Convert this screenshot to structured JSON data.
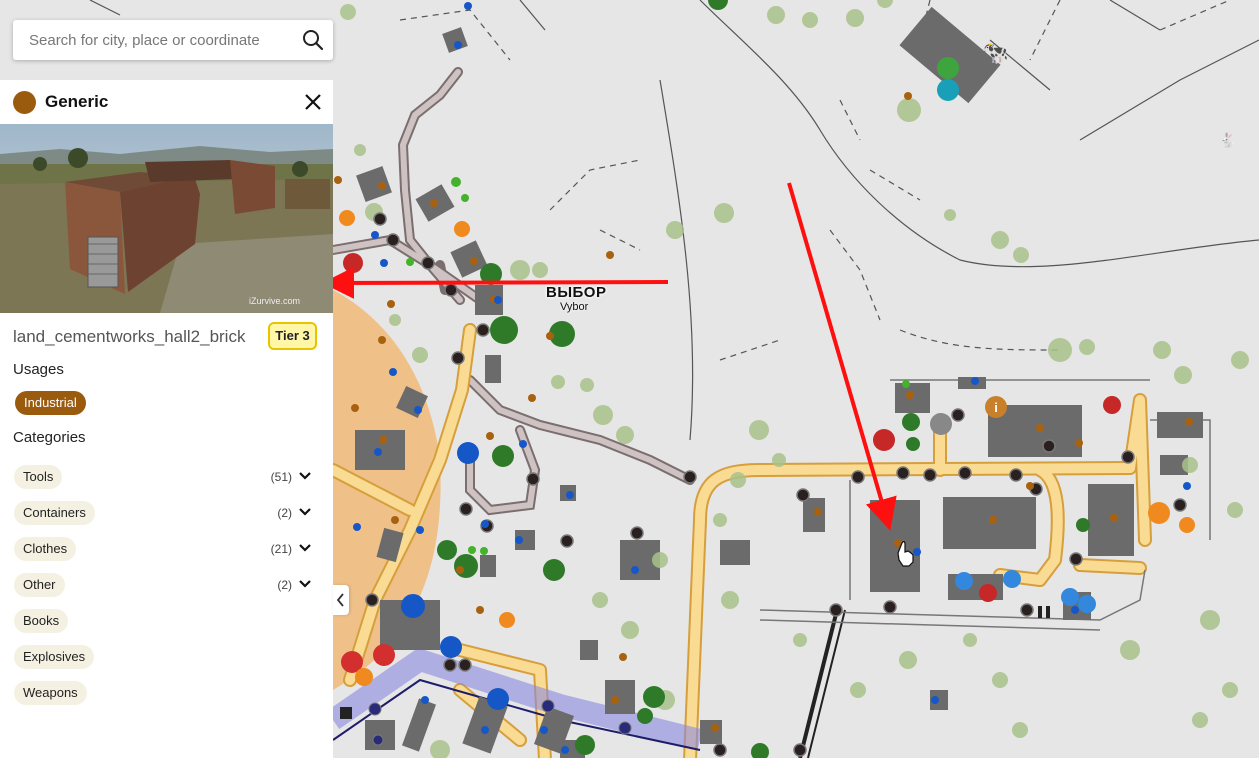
{
  "search": {
    "placeholder": "Search for city, place or coordinate",
    "icon": "search-icon"
  },
  "map": {
    "town_name_ru": "ВЫБОР",
    "town_name_en": "Vybor",
    "colors": {
      "background": "#e4e4e4",
      "road": "#f8d98a",
      "dirt_road": "#b4a8a8",
      "building": "#6e6e6e",
      "loot_marker": "#a8620f",
      "annotation_arrow": "#ff0000"
    }
  },
  "panel": {
    "title": "Generic",
    "type_color": "#9a5b0e",
    "photo_credit": "iZurvive.com",
    "object_name": "land_cementworks_hall2_brick",
    "tier": "Tier 3",
    "usages_title": "Usages",
    "usages": [
      "Industrial"
    ],
    "categories_title": "Categories",
    "categories": [
      {
        "label": "Tools",
        "count": "(51)",
        "expandable": true
      },
      {
        "label": "Containers",
        "count": "(2)",
        "expandable": true
      },
      {
        "label": "Clothes",
        "count": "(21)",
        "expandable": true
      },
      {
        "label": "Other",
        "count": "(2)",
        "expandable": true
      },
      {
        "label": "Books",
        "count": "",
        "expandable": false
      },
      {
        "label": "Explosives",
        "count": "",
        "expandable": false
      },
      {
        "label": "Weapons",
        "count": "",
        "expandable": false
      }
    ]
  }
}
